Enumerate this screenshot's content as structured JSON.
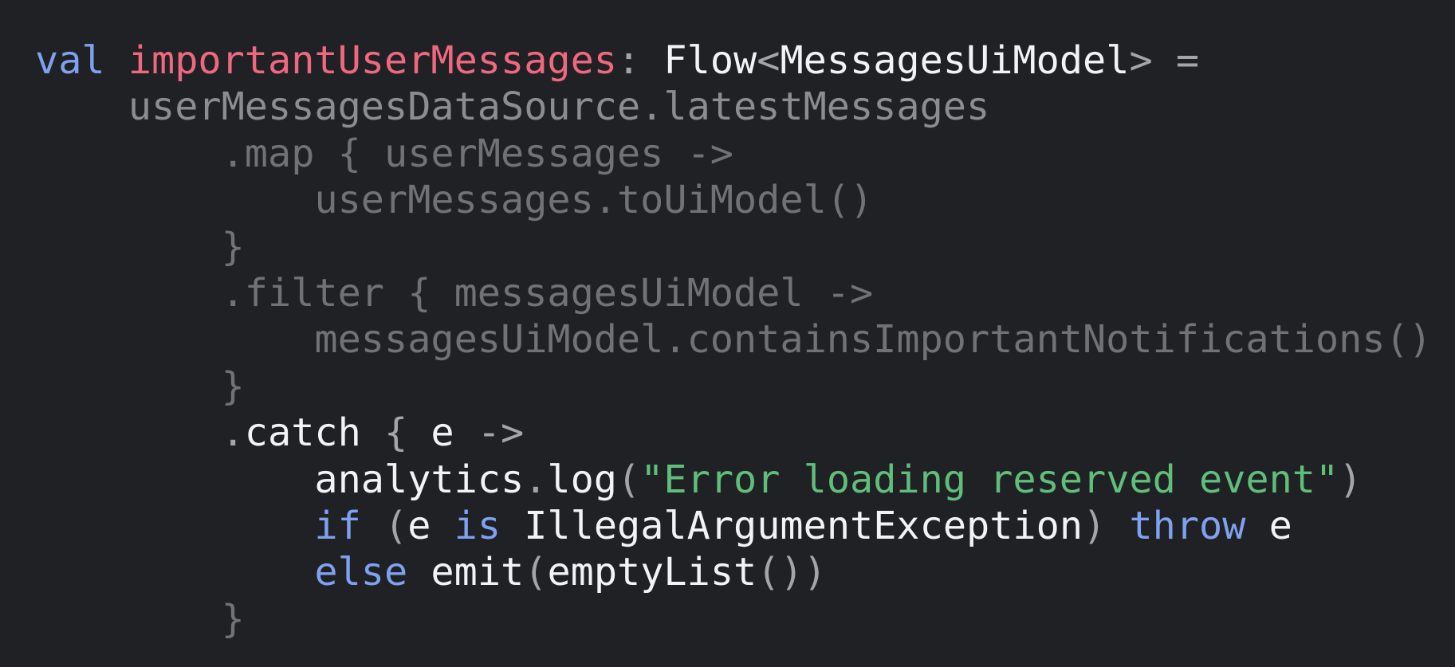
{
  "colors": {
    "background": "#202124",
    "keyword": "#7ea1f0",
    "declaration": "#f06880",
    "highlight": "#f1f3f4",
    "dimmed": "#8a8d91",
    "string": "#5fbf7a"
  },
  "lines": [
    [
      {
        "text": "val",
        "cls": "kw"
      },
      {
        "text": " ",
        "cls": "mute"
      },
      {
        "text": "importantUserMessages",
        "cls": "name"
      },
      {
        "text": ": ",
        "cls": "mute"
      },
      {
        "text": "Flow",
        "cls": "white"
      },
      {
        "text": "<",
        "cls": "mute"
      },
      {
        "text": "MessagesUiModel",
        "cls": "white"
      },
      {
        "text": "> =",
        "cls": "mute"
      }
    ],
    [
      {
        "text": "    userMessagesDataSource.latestMessages",
        "cls": "dim"
      }
    ],
    [
      {
        "text": "        .map { userMessages ->",
        "cls": "faint"
      }
    ],
    [
      {
        "text": "            userMessages.toUiModel()",
        "cls": "faint"
      }
    ],
    [
      {
        "text": "        }",
        "cls": "faint"
      }
    ],
    [
      {
        "text": "        .filter { messagesUiModel ->",
        "cls": "faint"
      }
    ],
    [
      {
        "text": "            messagesUiModel.containsImportantNotifications()",
        "cls": "faint"
      }
    ],
    [
      {
        "text": "        }",
        "cls": "faint"
      }
    ],
    [
      {
        "text": "        .",
        "cls": "mute"
      },
      {
        "text": "catch",
        "cls": "white"
      },
      {
        "text": " { ",
        "cls": "mute"
      },
      {
        "text": "e",
        "cls": "white"
      },
      {
        "text": " ->",
        "cls": "mute"
      }
    ],
    [
      {
        "text": "            ",
        "cls": "mute"
      },
      {
        "text": "analytics",
        "cls": "white"
      },
      {
        "text": ".",
        "cls": "mute"
      },
      {
        "text": "log",
        "cls": "white"
      },
      {
        "text": "(",
        "cls": "mute"
      },
      {
        "text": "\"Error loading reserved event\"",
        "cls": "str"
      },
      {
        "text": ")",
        "cls": "mute"
      }
    ],
    [
      {
        "text": "            ",
        "cls": "mute"
      },
      {
        "text": "if",
        "cls": "kw"
      },
      {
        "text": " (",
        "cls": "mute"
      },
      {
        "text": "e",
        "cls": "white"
      },
      {
        "text": " ",
        "cls": "mute"
      },
      {
        "text": "is",
        "cls": "kw"
      },
      {
        "text": " ",
        "cls": "mute"
      },
      {
        "text": "IllegalArgumentException",
        "cls": "white"
      },
      {
        "text": ") ",
        "cls": "mute"
      },
      {
        "text": "throw",
        "cls": "kw"
      },
      {
        "text": " ",
        "cls": "mute"
      },
      {
        "text": "e",
        "cls": "white"
      }
    ],
    [
      {
        "text": "            ",
        "cls": "mute"
      },
      {
        "text": "else",
        "cls": "kw"
      },
      {
        "text": " ",
        "cls": "mute"
      },
      {
        "text": "emit",
        "cls": "white"
      },
      {
        "text": "(",
        "cls": "mute"
      },
      {
        "text": "emptyList",
        "cls": "white"
      },
      {
        "text": "())",
        "cls": "mute"
      }
    ],
    [
      {
        "text": "        }",
        "cls": "faint"
      }
    ]
  ]
}
